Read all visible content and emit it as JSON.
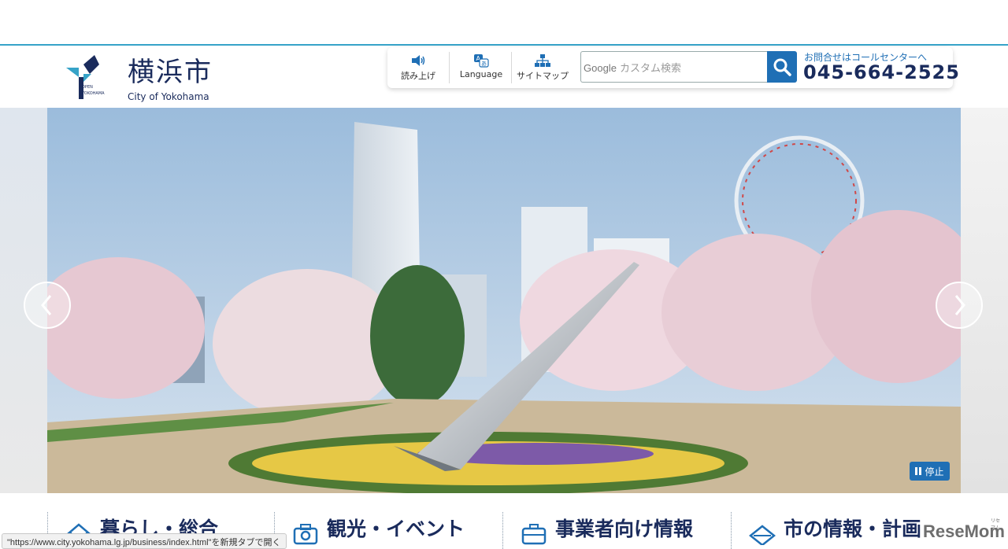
{
  "header": {
    "logo_title": "横浜市",
    "logo_subtitle": "City of Yokohama",
    "logo_mark_text_1": "OPEN",
    "logo_mark_text_2": "YOKOHAMA"
  },
  "utility": {
    "read_aloud": "読み上げ",
    "language": "Language",
    "sitemap": "サイトマップ",
    "search_brand": "Google",
    "search_placeholder": " カスタム検索",
    "contact_label": "お問合せはコールセンターへ",
    "contact_phone": "045-664-2525"
  },
  "hero": {
    "pause_label": "停止"
  },
  "nav": {
    "items": [
      {
        "label": "暮らし・総合",
        "icon": "house-icon"
      },
      {
        "label": "観光・イベント",
        "icon": "camera-icon"
      },
      {
        "label": "事業者向け情報",
        "icon": "briefcase-icon"
      },
      {
        "label": "市の情報・計画",
        "icon": "diamond-icon"
      }
    ]
  },
  "status_bar": "\"https://www.city.yokohama.lg.jp/business/index.html\"を新規タブで開く",
  "watermark": {
    "text": "ReseMom",
    "ruby": "リセマム"
  },
  "colors": {
    "accent": "#1f6fb5",
    "navy": "#1a2b5c",
    "top_border": "#36a3c8"
  }
}
